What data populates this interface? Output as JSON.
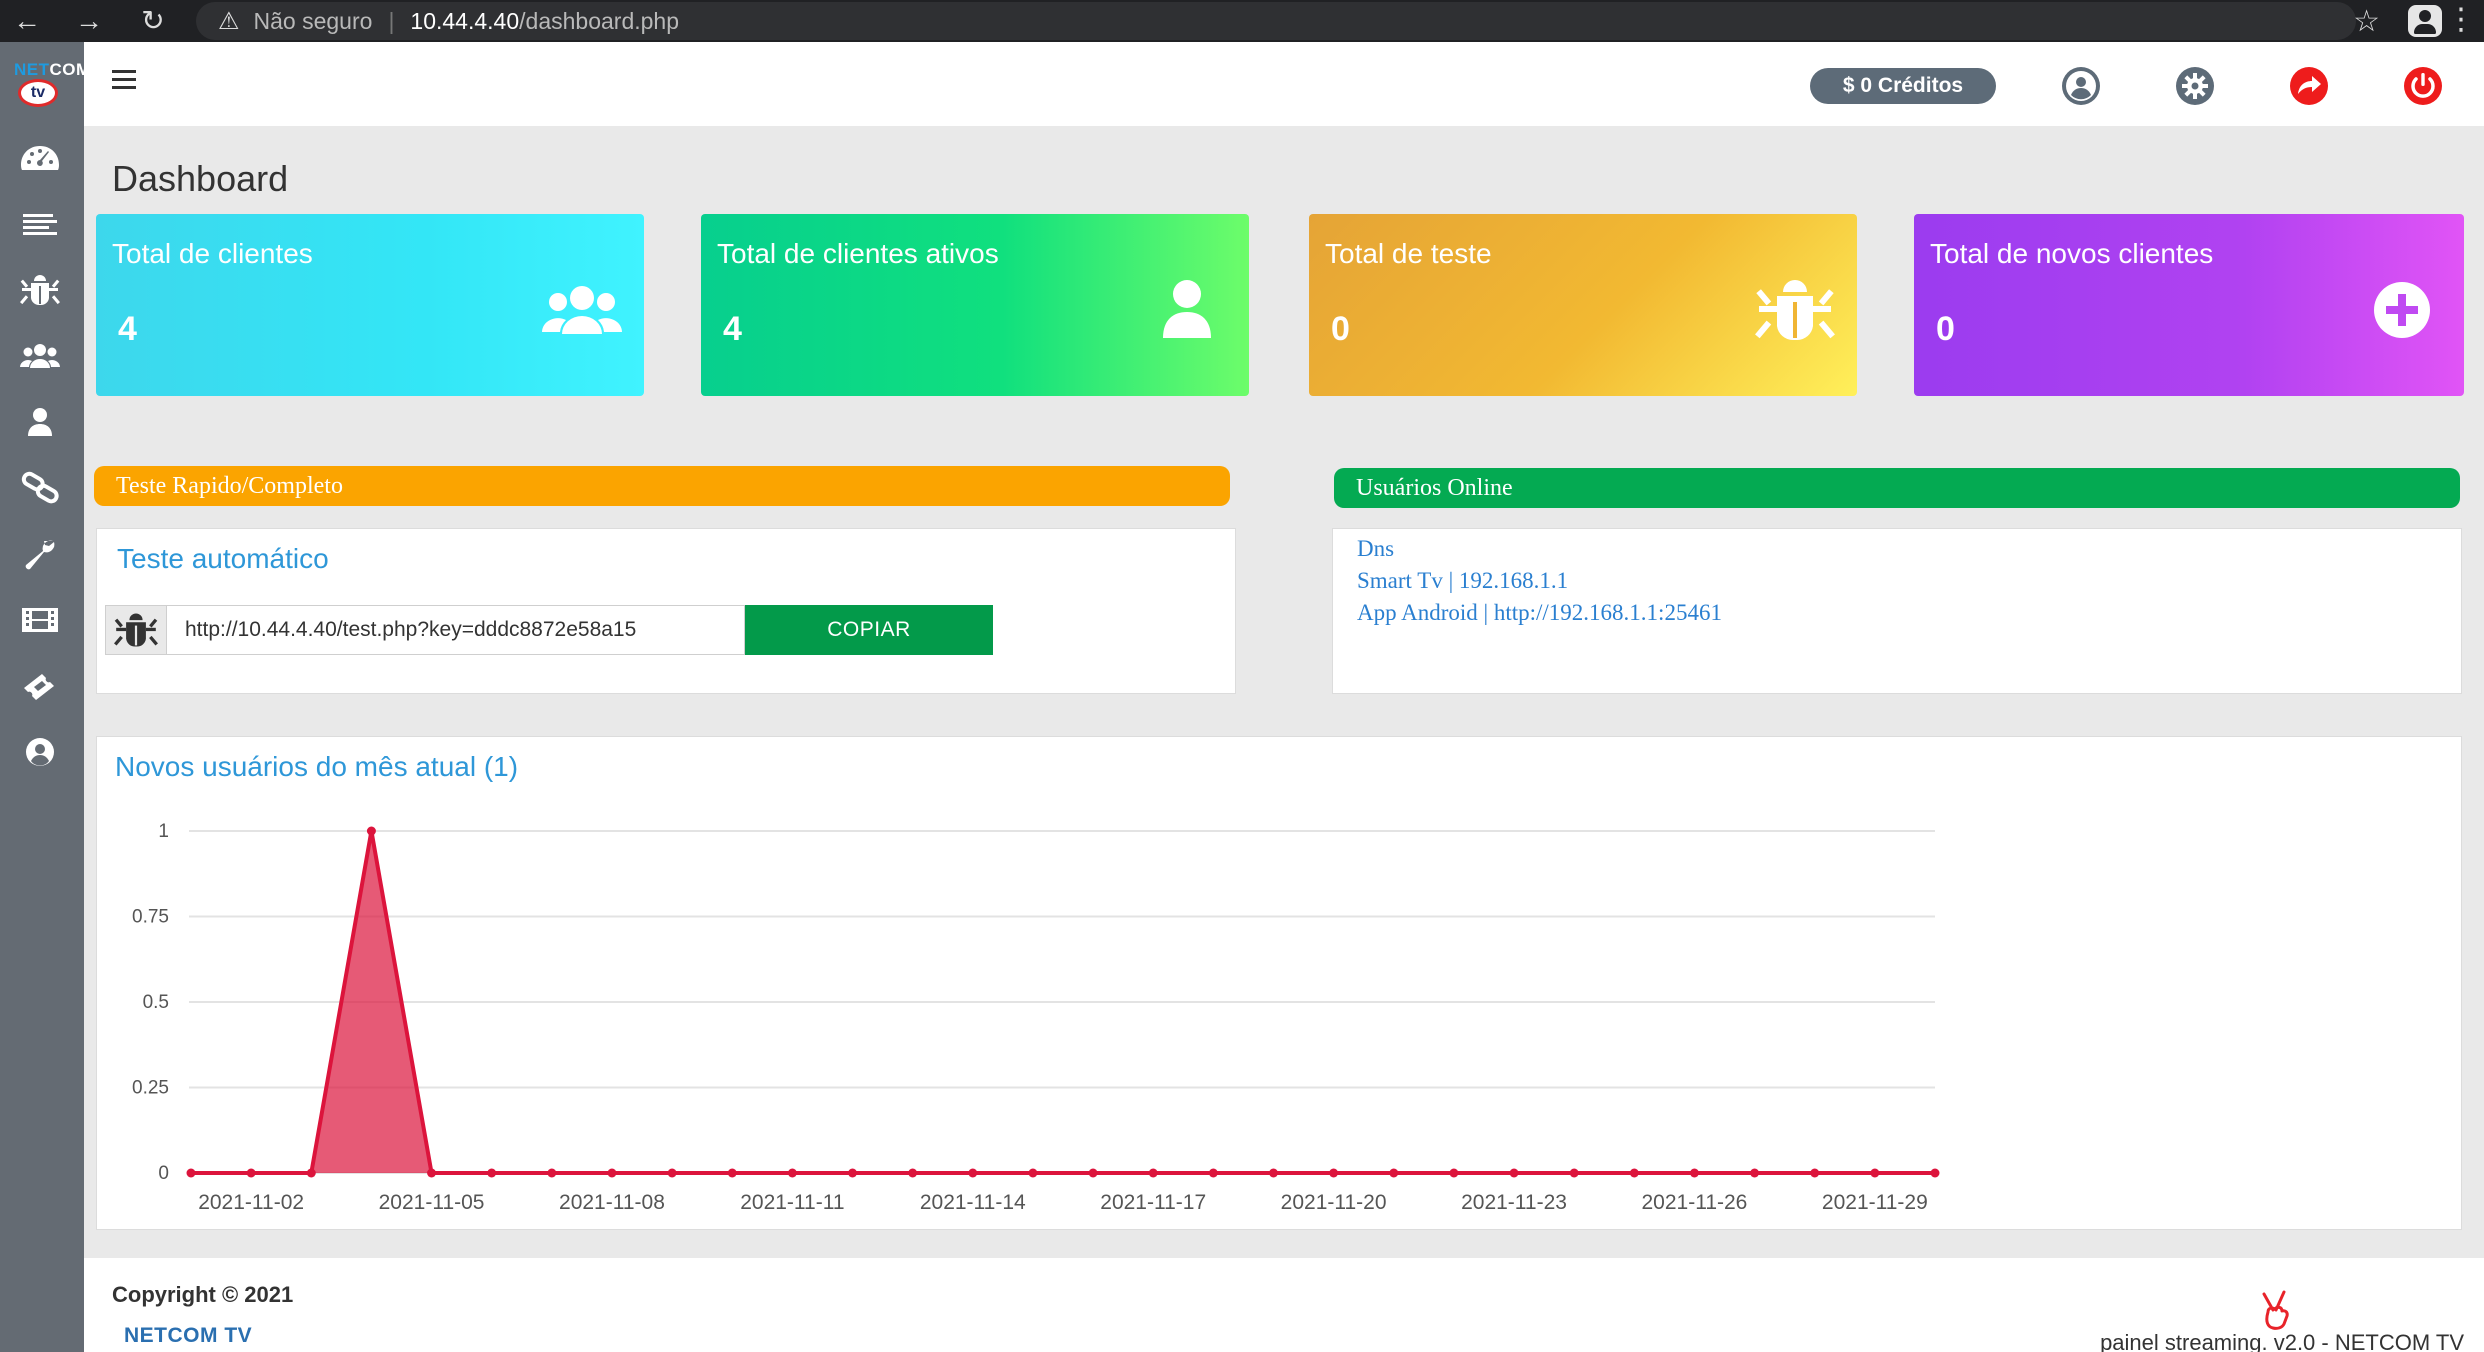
{
  "browser": {
    "security": "Não seguro",
    "url_host": "10.44.4.40",
    "url_path": "/dashboard.php"
  },
  "logo": {
    "text_a": "NET",
    "text_b": "COM",
    "badge": "tv"
  },
  "sidebar": {
    "items": [
      {
        "name": "dashboard",
        "icon": "tachometer-icon"
      },
      {
        "name": "list",
        "icon": "list-icon"
      },
      {
        "name": "tests",
        "icon": "bug-icon"
      },
      {
        "name": "clients",
        "icon": "users-icon"
      },
      {
        "name": "user",
        "icon": "user-icon"
      },
      {
        "name": "links",
        "icon": "chain-icon"
      },
      {
        "name": "tools",
        "icon": "wrench-icon"
      },
      {
        "name": "videos",
        "icon": "film-icon"
      },
      {
        "name": "tickets",
        "icon": "ticket-icon"
      },
      {
        "name": "profile",
        "icon": "user-circle-icon"
      }
    ]
  },
  "header": {
    "credits": "$ 0 Créditos",
    "icons": [
      "user-circle-icon",
      "gear-icon",
      "share-icon",
      "power-icon"
    ],
    "colors": {
      "credits_bg": "#5d6b78",
      "action_red": "#ee1c1c",
      "icon_gray": "#5d6b78"
    }
  },
  "page": {
    "title": "Dashboard"
  },
  "cards": [
    {
      "title": "Total de clientes",
      "value": "4",
      "icon": "users-icon"
    },
    {
      "title": "Total de clientes ativos",
      "value": "4",
      "icon": "user-icon"
    },
    {
      "title": "Total de teste",
      "value": "0",
      "icon": "bug-icon"
    },
    {
      "title": "Total de novos clientes",
      "value": "0",
      "icon": "plus-circle-icon"
    }
  ],
  "test_section": {
    "banner": "Teste Rapido/Completo",
    "panel_title": "Teste automático",
    "url": "http://10.44.4.40/test.php?key=dddc8872e58a15",
    "copy_label": "COPIAR"
  },
  "online_section": {
    "banner": "Usuários Online",
    "lines": [
      "Dns",
      "Smart Tv | 192.168.1.1",
      "App Android | http://192.168.1.1:25461"
    ]
  },
  "chart_data": {
    "type": "area",
    "title": "Novos usuários do mês atual (1)",
    "x": [
      "2021-11-01",
      "2021-11-02",
      "2021-11-03",
      "2021-11-04",
      "2021-11-05",
      "2021-11-06",
      "2021-11-07",
      "2021-11-08",
      "2021-11-09",
      "2021-11-10",
      "2021-11-11",
      "2021-11-12",
      "2021-11-13",
      "2021-11-14",
      "2021-11-15",
      "2021-11-16",
      "2021-11-17",
      "2021-11-18",
      "2021-11-19",
      "2021-11-20",
      "2021-11-21",
      "2021-11-22",
      "2021-11-23",
      "2021-11-24",
      "2021-11-25",
      "2021-11-26",
      "2021-11-27",
      "2021-11-28",
      "2021-11-29",
      "2021-11-30"
    ],
    "values": [
      0,
      0,
      0,
      1,
      0,
      0,
      0,
      0,
      0,
      0,
      0,
      0,
      0,
      0,
      0,
      0,
      0,
      0,
      0,
      0,
      0,
      0,
      0,
      0,
      0,
      0,
      0,
      0,
      0,
      0
    ],
    "x_tick_labels": [
      "2021-11-02",
      "2021-11-05",
      "2021-11-08",
      "2021-11-11",
      "2021-11-14",
      "2021-11-17",
      "2021-11-20",
      "2021-11-23",
      "2021-11-26",
      "2021-11-29"
    ],
    "y_ticks": [
      "0",
      "0.25",
      "0.5",
      "0.75",
      "1"
    ],
    "ylim": [
      0,
      1
    ],
    "grid": true,
    "color": "#dc143c"
  },
  "footer": {
    "copyright": "Copyright © 2021",
    "brand": "NETCOM TV",
    "version": "painel streaming. v2.0 - NETCOM TV"
  }
}
